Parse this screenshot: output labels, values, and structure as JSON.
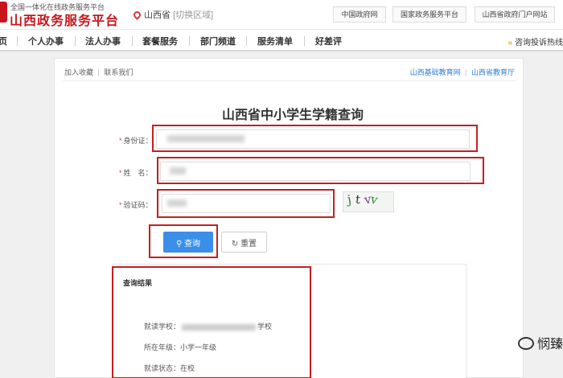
{
  "header": {
    "tagline": "全国一体化在线政务服务平台",
    "platform_name": "山西政务服务平台",
    "region": "山西省",
    "region_switch": "[切换区域]",
    "links": [
      "中国政府网",
      "国家政务服务平台",
      "山西省政府门户网站"
    ]
  },
  "nav": {
    "items": [
      "页",
      "个人办事",
      "法人办事",
      "套餐服务",
      "部门频道",
      "服务清单",
      "好差评"
    ],
    "complaint": "咨询投诉热线"
  },
  "utility": {
    "bookmark": "加入收藏",
    "contact": "联系我们",
    "left_sep": "|",
    "right_links": [
      "山西基础教育网",
      "山西省教育厅"
    ],
    "right_sep": "|"
  },
  "page_title": "山西省中小学生学籍查询",
  "form": {
    "required_mark": "*",
    "id_label": "身份证：",
    "name_label": "姓　名：",
    "captcha_label": "验证码：",
    "captcha_chars": [
      "j",
      "t",
      "v",
      "v"
    ],
    "query_label": "查询",
    "reset_label": "重置"
  },
  "result": {
    "title": "查询结果",
    "school_label": "就读学校：",
    "school_suffix": "学校",
    "grade_label": "所在年级：",
    "grade_value": "小学一年级",
    "status_label": "就读状态：",
    "status_value": "在校"
  },
  "watermark": "悯臻",
  "colors": {
    "brand_red": "#c8161d",
    "highlight_red": "#c41f22",
    "button_blue": "#3b8fe8",
    "link_blue": "#2f7ed8"
  },
  "icons": [
    "logo-mark-icon",
    "location-pin-icon",
    "search-icon",
    "refresh-icon",
    "double-chevron-right-icon",
    "wechat-icon"
  ]
}
